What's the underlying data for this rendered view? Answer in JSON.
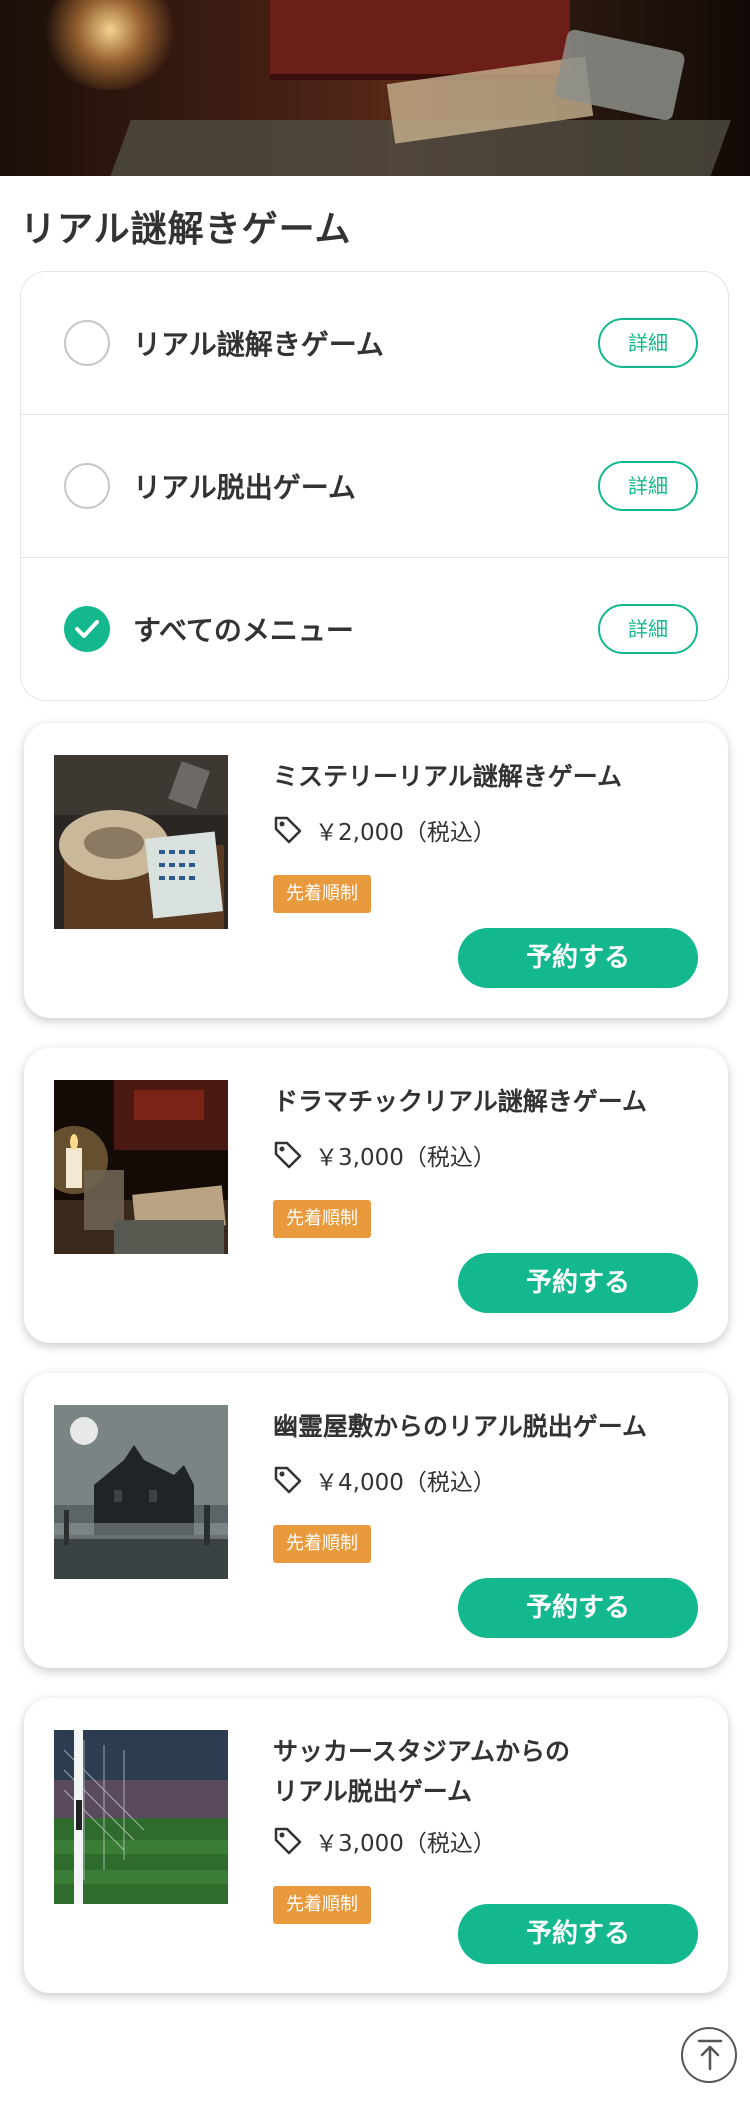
{
  "page": {
    "title": "リアル謎解きゲーム"
  },
  "menu": {
    "detail_label": "詳細",
    "items": [
      {
        "label": "リアル謎解きゲーム",
        "checked": false
      },
      {
        "label": "リアル脱出ゲーム",
        "checked": false
      },
      {
        "label": "すべてのメニュー",
        "checked": true
      }
    ]
  },
  "cards": [
    {
      "title": "ミステリーリアル謎解きゲーム",
      "price": "￥2,000（税込）",
      "badge": "先着順制",
      "button": "予約する",
      "image": "mystery-desk-image"
    },
    {
      "title": "ドラマチックリアル謎解きゲーム",
      "price": "￥3,000（税込）",
      "badge": "先着順制",
      "button": "予約する",
      "image": "candle-desk-image"
    },
    {
      "title": "幽霊屋敷からのリアル脱出ゲーム",
      "price": "￥4,000（税込）",
      "badge": "先着順制",
      "button": "予約する",
      "image": "haunted-house-image"
    },
    {
      "title": "サッカースタジアムからの\nリアル脱出ゲーム",
      "price": "￥3,000（税込）",
      "badge": "先着順制",
      "button": "予約する",
      "image": "soccer-stadium-image"
    }
  ],
  "colors": {
    "accent": "#14b88f",
    "badge": "#e89a3c",
    "text": "#333333"
  },
  "icons": {
    "price": "tag-icon",
    "scroll_top": "arrow-up-icon",
    "check": "check-icon"
  }
}
